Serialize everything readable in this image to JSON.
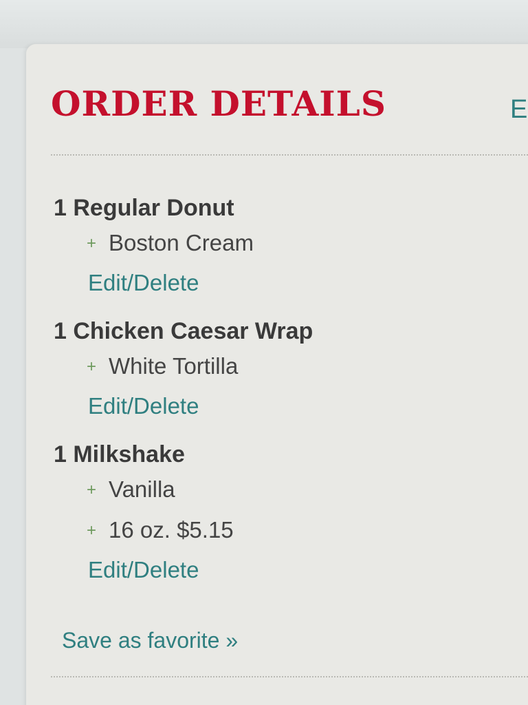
{
  "header": {
    "title": "ORDER DETAILS",
    "next_tab_partial": "E"
  },
  "order": {
    "items": [
      {
        "name": "1 Regular Donut",
        "options": [
          "Boston Cream"
        ],
        "edit_label": "Edit",
        "separator": "/",
        "delete_label": "Delete"
      },
      {
        "name": "1 Chicken Caesar Wrap",
        "options": [
          "White Tortilla"
        ],
        "edit_label": "Edit",
        "separator": "/",
        "delete_label": "Delete"
      },
      {
        "name": "1 Milkshake",
        "options": [
          "Vanilla",
          "16 oz. $5.15"
        ],
        "edit_label": "Edit",
        "separator": "/",
        "delete_label": "Delete"
      }
    ],
    "option_marker": "+"
  },
  "footer": {
    "save_favorite_label": "Save as favorite »"
  },
  "colors": {
    "title_red": "#c4102d",
    "link_teal": "#2f7f80",
    "plus_green": "#6e9a5e",
    "panel_bg": "#e9e9e5"
  }
}
